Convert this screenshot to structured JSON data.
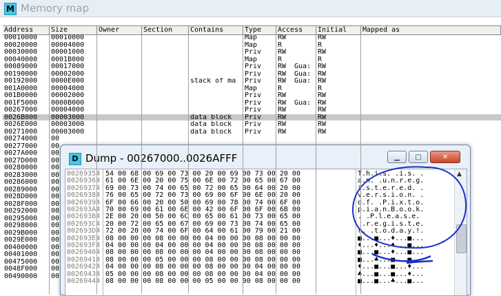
{
  "memory_map": {
    "title": "Memory map",
    "icon_letter": "M",
    "columns": [
      "Address",
      "Size",
      "Owner",
      "Section",
      "Contains",
      "Type",
      "Access",
      "Initial",
      "Mapped as"
    ],
    "rows": [
      {
        "address": "00010000",
        "size": "00010000",
        "owner": "",
        "section": "",
        "contains": "",
        "type": "Map",
        "access": "RW",
        "guard": "",
        "initial": "RW",
        "mapped": ""
      },
      {
        "address": "00020000",
        "size": "00004000",
        "owner": "",
        "section": "",
        "contains": "",
        "type": "Map",
        "access": "R",
        "guard": "",
        "initial": "R",
        "mapped": ""
      },
      {
        "address": "00030000",
        "size": "00001000",
        "owner": "",
        "section": "",
        "contains": "",
        "type": "Priv",
        "access": "RW",
        "guard": "",
        "initial": "RW",
        "mapped": ""
      },
      {
        "address": "00040000",
        "size": "0001B000",
        "owner": "",
        "section": "",
        "contains": "",
        "type": "Map",
        "access": "R",
        "guard": "",
        "initial": "R",
        "mapped": ""
      },
      {
        "address": "00089000",
        "size": "00017000",
        "owner": "",
        "section": "",
        "contains": "",
        "type": "Priv",
        "access": "RW",
        "guard": "Gua:",
        "initial": "RW",
        "mapped": ""
      },
      {
        "address": "00190000",
        "size": "00002000",
        "owner": "",
        "section": "",
        "contains": "",
        "type": "Priv",
        "access": "RW",
        "guard": "Gua:",
        "initial": "RW",
        "mapped": ""
      },
      {
        "address": "00192000",
        "size": "0000E000",
        "owner": "",
        "section": "",
        "contains": "stack of ma",
        "type": "Priv",
        "access": "RW",
        "guard": "Gua:",
        "initial": "RW",
        "mapped": ""
      },
      {
        "address": "001A0000",
        "size": "00004000",
        "owner": "",
        "section": "",
        "contains": "",
        "type": "Map",
        "access": "R",
        "guard": "",
        "initial": "R",
        "mapped": ""
      },
      {
        "address": "001B0000",
        "size": "00002000",
        "owner": "",
        "section": "",
        "contains": "",
        "type": "Priv",
        "access": "RW",
        "guard": "",
        "initial": "RW",
        "mapped": ""
      },
      {
        "address": "001F5000",
        "size": "0000B000",
        "owner": "",
        "section": "",
        "contains": "",
        "type": "Priv",
        "access": "RW",
        "guard": "Gua:",
        "initial": "RW",
        "mapped": ""
      },
      {
        "address": "00267000",
        "size": "00004000",
        "owner": "",
        "section": "",
        "contains": "",
        "type": "Priv",
        "access": "RW",
        "guard": "",
        "initial": "RW",
        "mapped": ""
      },
      {
        "address": "0026B000",
        "size": "00003000",
        "owner": "",
        "section": "",
        "contains": "data block",
        "type": "Priv",
        "access": "RW",
        "guard": "",
        "initial": "RW",
        "mapped": "",
        "selected": true
      },
      {
        "address": "0026E000",
        "size": "00003000",
        "owner": "",
        "section": "",
        "contains": "data block",
        "type": "Priv",
        "access": "RW",
        "guard": "",
        "initial": "RW",
        "mapped": ""
      },
      {
        "address": "00271000",
        "size": "00003000",
        "owner": "",
        "section": "",
        "contains": "data block",
        "type": "Priv",
        "access": "RW",
        "guard": "",
        "initial": "RW",
        "mapped": ""
      },
      {
        "address": "00274000",
        "size": "00",
        "owner": "",
        "section": "",
        "contains": "",
        "type": "",
        "access": "",
        "guard": "",
        "initial": "",
        "mapped": ""
      },
      {
        "address": "00277000",
        "size": "00",
        "owner": "",
        "section": "",
        "contains": "",
        "type": "",
        "access": "",
        "guard": "",
        "initial": "",
        "mapped": ""
      },
      {
        "address": "0027A000",
        "size": "00",
        "owner": "",
        "section": "",
        "contains": "",
        "type": "",
        "access": "",
        "guard": "",
        "initial": "",
        "mapped": ""
      },
      {
        "address": "0027D000",
        "size": "00",
        "owner": "",
        "section": "",
        "contains": "",
        "type": "",
        "access": "",
        "guard": "",
        "initial": "",
        "mapped": ""
      },
      {
        "address": "00280000",
        "size": "00",
        "owner": "",
        "section": "",
        "contains": "",
        "type": "",
        "access": "",
        "guard": "",
        "initial": "",
        "mapped": ""
      },
      {
        "address": "00283000",
        "size": "00",
        "owner": "",
        "section": "",
        "contains": "",
        "type": "",
        "access": "",
        "guard": "",
        "initial": "",
        "mapped": ""
      },
      {
        "address": "00286000",
        "size": "00",
        "owner": "",
        "section": "",
        "contains": "",
        "type": "",
        "access": "",
        "guard": "",
        "initial": "",
        "mapped": ""
      },
      {
        "address": "00289000",
        "size": "00",
        "owner": "",
        "section": "",
        "contains": "",
        "type": "",
        "access": "",
        "guard": "",
        "initial": "",
        "mapped": ""
      },
      {
        "address": "0028D000",
        "size": "00",
        "owner": "",
        "section": "",
        "contains": "",
        "type": "",
        "access": "",
        "guard": "",
        "initial": "",
        "mapped": ""
      },
      {
        "address": "0028F000",
        "size": "00",
        "owner": "",
        "section": "",
        "contains": "",
        "type": "",
        "access": "",
        "guard": "",
        "initial": "",
        "mapped": ""
      },
      {
        "address": "00292000",
        "size": "00",
        "owner": "",
        "section": "",
        "contains": "",
        "type": "",
        "access": "",
        "guard": "",
        "initial": "",
        "mapped": ""
      },
      {
        "address": "00295000",
        "size": "00",
        "owner": "",
        "section": "",
        "contains": "",
        "type": "",
        "access": "",
        "guard": "",
        "initial": "",
        "mapped": ""
      },
      {
        "address": "00298000",
        "size": "00",
        "owner": "",
        "section": "",
        "contains": "",
        "type": "",
        "access": "",
        "guard": "",
        "initial": "",
        "mapped": ""
      },
      {
        "address": "0029B000",
        "size": "00",
        "owner": "",
        "section": "",
        "contains": "",
        "type": "",
        "access": "",
        "guard": "",
        "initial": "",
        "mapped": ""
      },
      {
        "address": "0029E000",
        "size": "00",
        "owner": "",
        "section": "",
        "contains": "",
        "type": "",
        "access": "",
        "guard": "",
        "initial": "",
        "mapped": ""
      },
      {
        "address": "00400000",
        "size": "00",
        "owner": "",
        "section": "",
        "contains": "",
        "type": "",
        "access": "",
        "guard": "",
        "initial": "",
        "mapped": ""
      },
      {
        "address": "00401000",
        "size": "00",
        "owner": "",
        "section": "",
        "contains": "",
        "type": "",
        "access": "",
        "guard": "",
        "initial": "",
        "mapped": ""
      },
      {
        "address": "00475000",
        "size": "00",
        "owner": "",
        "section": "",
        "contains": "",
        "type": "",
        "access": "",
        "guard": "",
        "initial": "",
        "mapped": ""
      },
      {
        "address": "0048F000",
        "size": "00",
        "owner": "",
        "section": "",
        "contains": "",
        "type": "",
        "access": "",
        "guard": "",
        "initial": "",
        "mapped": ""
      },
      {
        "address": "00490000",
        "size": "00",
        "owner": "",
        "section": "",
        "contains": "",
        "type": "",
        "access": "",
        "guard": "",
        "initial": "",
        "mapped": ""
      }
    ]
  },
  "dump": {
    "icon_letter": "D",
    "title": "Dump - 00267000..0026AFFF",
    "buttons": {
      "minimize": "▁",
      "maximize": "□",
      "close": "✕"
    },
    "scroll_up": "▲",
    "rows": [
      {
        "addr": "00269354",
        "hex": "54 00 68 00 69 00 73 00 20 00 69 00 73 00 20 00",
        "ascii": "T.h.i.s. .i.s. ."
      },
      {
        "addr": "00269364",
        "hex": "61 00 6E 00 20 00 75 00 6E 00 72 00 65 00 67 00",
        "ascii": "a.n. .u.n.r.e.g."
      },
      {
        "addr": "00269374",
        "hex": "69 00 73 00 74 00 65 00 72 00 65 00 64 00 20 00",
        "ascii": "i.s.t.e.r.e.d. ."
      },
      {
        "addr": "00269384",
        "hex": "76 00 65 00 72 00 73 00 69 00 6F 00 6E 00 20 00",
        "ascii": "v.e.r.s.i.o.n. ."
      },
      {
        "addr": "00269394",
        "hex": "6F 00 66 00 20 00 50 00 69 00 78 00 74 00 6F 00",
        "ascii": "o.f. .P.i.x.t.o."
      },
      {
        "addr": "002693A4",
        "hex": "70 00 69 00 61 00 6E 00 42 00 6F 00 6F 00 6B 00",
        "ascii": "p.i.a.n.B.o.o.k."
      },
      {
        "addr": "002693B4",
        "hex": "2E 00 20 00 50 00 6C 00 65 00 61 00 73 00 65 00",
        "ascii": ". .P.l.e.a.s.e."
      },
      {
        "addr": "002693C4",
        "hex": "20 00 72 00 65 00 67 00 69 00 73 00 74 00 65 00",
        "ascii": " .r.e.g.i.s.t.e."
      },
      {
        "addr": "002693D4",
        "hex": "72 00 20 00 74 00 6F 00 64 00 61 00 79 00 21 00",
        "ascii": "r. .t.o.d.a.y.!."
      },
      {
        "addr": "002693E4",
        "hex": "08 00 00 00 08 00 00 00 04 00 00 00 08 00 00 00",
        "ascii": "■...■...♦...■..."
      },
      {
        "addr": "002693F4",
        "hex": "04 00 00 00 04 00 00 00 04 00 00 00 08 00 00 00",
        "ascii": "♦...♦...♦...■..."
      },
      {
        "addr": "00269404",
        "hex": "08 00 00 00 08 00 00 00 04 00 00 00 08 00 00 00",
        "ascii": "■...■...♦...■..."
      },
      {
        "addr": "00269414",
        "hex": "08 00 00 00 05 00 00 00 08 00 00 00 08 00 00 00",
        "ascii": "■...♣...■...■..."
      },
      {
        "addr": "00269424",
        "hex": "04 00 00 00 08 00 00 00 08 00 00 00 04 00 00 00",
        "ascii": "♦...■...■...♦..."
      },
      {
        "addr": "00269434",
        "hex": "05 00 00 00 08 00 00 00 08 00 00 00 04 00 00 00",
        "ascii": "♣...■...■...♦..."
      },
      {
        "addr": "00269444",
        "hex": "08 00 00 00 08 00 00 00 05 00 00 00 08 00 00 00",
        "ascii": "■...■...♣...■..."
      }
    ]
  },
  "annotation_color": "#1a2fc8"
}
